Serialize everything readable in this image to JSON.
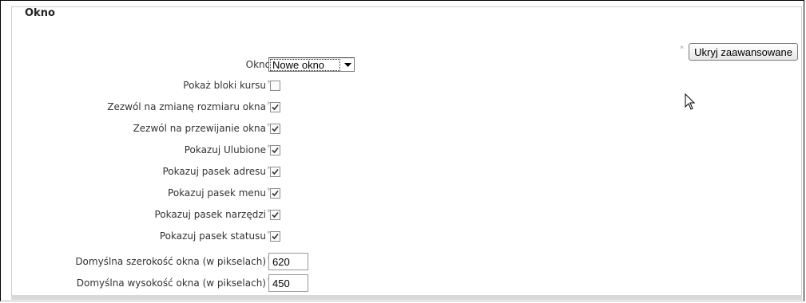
{
  "fieldset": {
    "legend": "Okno"
  },
  "advanced_button": {
    "label": "Ukryj zaawansowane",
    "required_mark": "*"
  },
  "window_select": {
    "label": "Okno",
    "value": "Nowe okno"
  },
  "checkboxes": [
    {
      "label": "Pokaż bloki kursu",
      "checked": false
    },
    {
      "label": "Zezwól na zmianę rozmiaru okna",
      "checked": true
    },
    {
      "label": "Zezwól na przewijanie okna",
      "checked": true
    },
    {
      "label": "Pokazuj Ulubione",
      "checked": true
    },
    {
      "label": "Pokazuj pasek adresu",
      "checked": true
    },
    {
      "label": "Pokazuj pasek menu",
      "checked": true
    },
    {
      "label": "Pokazuj pasek narzędzi",
      "checked": true
    },
    {
      "label": "Pokazuj pasek statusu",
      "checked": true
    }
  ],
  "width_field": {
    "label": "Domyślna szerokość okna (w pikselach)",
    "value": "620"
  },
  "height_field": {
    "label": "Domyślna wysokość okna (w pikselach)",
    "value": "450"
  },
  "required_mark": "*"
}
